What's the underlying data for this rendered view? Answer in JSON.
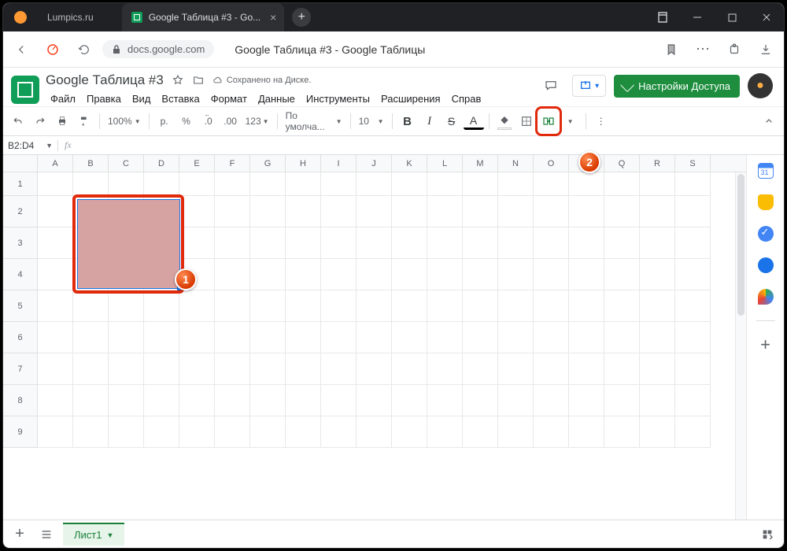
{
  "browser": {
    "inactive_tab": "Lumpics.ru",
    "active_tab": "Google Таблица #3 - Gо...",
    "url_host": "docs.google.com",
    "page_title": "Google Таблица #3 - Google Таблицы"
  },
  "doc": {
    "title": "Google Таблица #3",
    "saved": "Сохранено на Диске.",
    "share": "Настройки Доступа"
  },
  "menu": {
    "file": "Файл",
    "edit": "Правка",
    "view": "Вид",
    "insert": "Вставка",
    "format": "Формат",
    "data": "Данные",
    "tools": "Инструменты",
    "extensions": "Расширения",
    "help": "Справ"
  },
  "toolbar": {
    "zoom": "100%",
    "currency": "р.",
    "percent": "%",
    "dec_dec": ".0",
    "dec_inc": ".00",
    "num_fmt": "123",
    "font": "По умолча...",
    "size": "10",
    "bold": "B",
    "italic": "I",
    "strike": "S",
    "textcolor": "A"
  },
  "namebox": "B2:D4",
  "fx": "fx",
  "cols": [
    "A",
    "B",
    "C",
    "D",
    "E",
    "F",
    "G",
    "H",
    "I",
    "J",
    "K",
    "L",
    "M",
    "N",
    "O",
    "P",
    "Q",
    "R",
    "S"
  ],
  "rows": [
    "1",
    "2",
    "3",
    "4",
    "5",
    "6",
    "7",
    "8",
    "9"
  ],
  "tabs": {
    "sheet1": "Лист1"
  },
  "badges": {
    "one": "1",
    "two": "2"
  }
}
